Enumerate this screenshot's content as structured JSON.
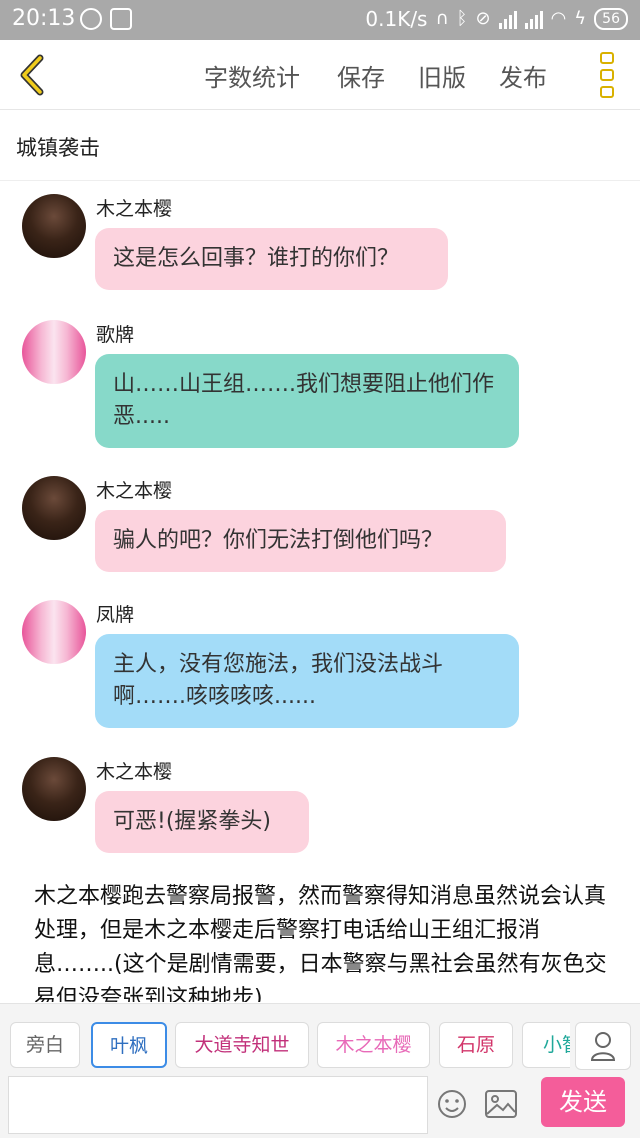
{
  "status_bar": {
    "time": "20:13",
    "network_speed": "0.1K/s",
    "battery": "56",
    "icons": [
      "weibo-icon",
      "baidu-icon",
      "headphones-icon",
      "bluetooth-icon",
      "bell-muted-icon",
      "signal-hd-icon",
      "signal-icon",
      "wifi-icon",
      "charging-icon",
      "battery-icon"
    ]
  },
  "header": {
    "actions": [
      "字数统计",
      "保存",
      "旧版",
      "发布"
    ],
    "accent_color": "#d9b100"
  },
  "story": {
    "title": "城镇袭击"
  },
  "messages": [
    {
      "speaker": "木之本樱",
      "text": "这是怎么回事？谁打的你们？",
      "bubble_color": "#fcd3de"
    },
    {
      "speaker": "歌牌",
      "text": "山……山王组…….我们想要阻止他们作恶.....",
      "bubble_color": "#87d9c9"
    },
    {
      "speaker": "木之本樱",
      "text": "骗人的吧？你们无法打倒他们吗？",
      "bubble_color": "#fcd3de"
    },
    {
      "speaker": "凤牌",
      "text": "主人，没有您施法，我们没法战斗啊…….咳咳咳咳......",
      "bubble_color": "#a3dcf8"
    },
    {
      "speaker": "木之本樱",
      "text": "可恶!(握紧拳头)",
      "bubble_color": "#fcd3de"
    }
  ],
  "narration": "木之本樱跑去警察局报警，然而警察得知消息虽然说会认真处理，但是木之本樱走后警察打电话给山王组汇报消息……..(这个是剧情需要，日本警察与黑社会虽然有灰色交易但没夸张到这种地步)",
  "composer": {
    "characters": [
      {
        "label": "旁白",
        "color": "#666666"
      },
      {
        "label": "叶枫",
        "color": "#2f6fc0"
      },
      {
        "label": "大道寺知世",
        "color": "#c2307a"
      },
      {
        "label": "木之本樱",
        "color": "#e86ab8"
      },
      {
        "label": "石原",
        "color": "#d2356a"
      },
      {
        "label": "小智",
        "color": "#20a89a"
      }
    ],
    "input_value": "",
    "send_label": "发送",
    "send_color": "#f45d9a"
  }
}
